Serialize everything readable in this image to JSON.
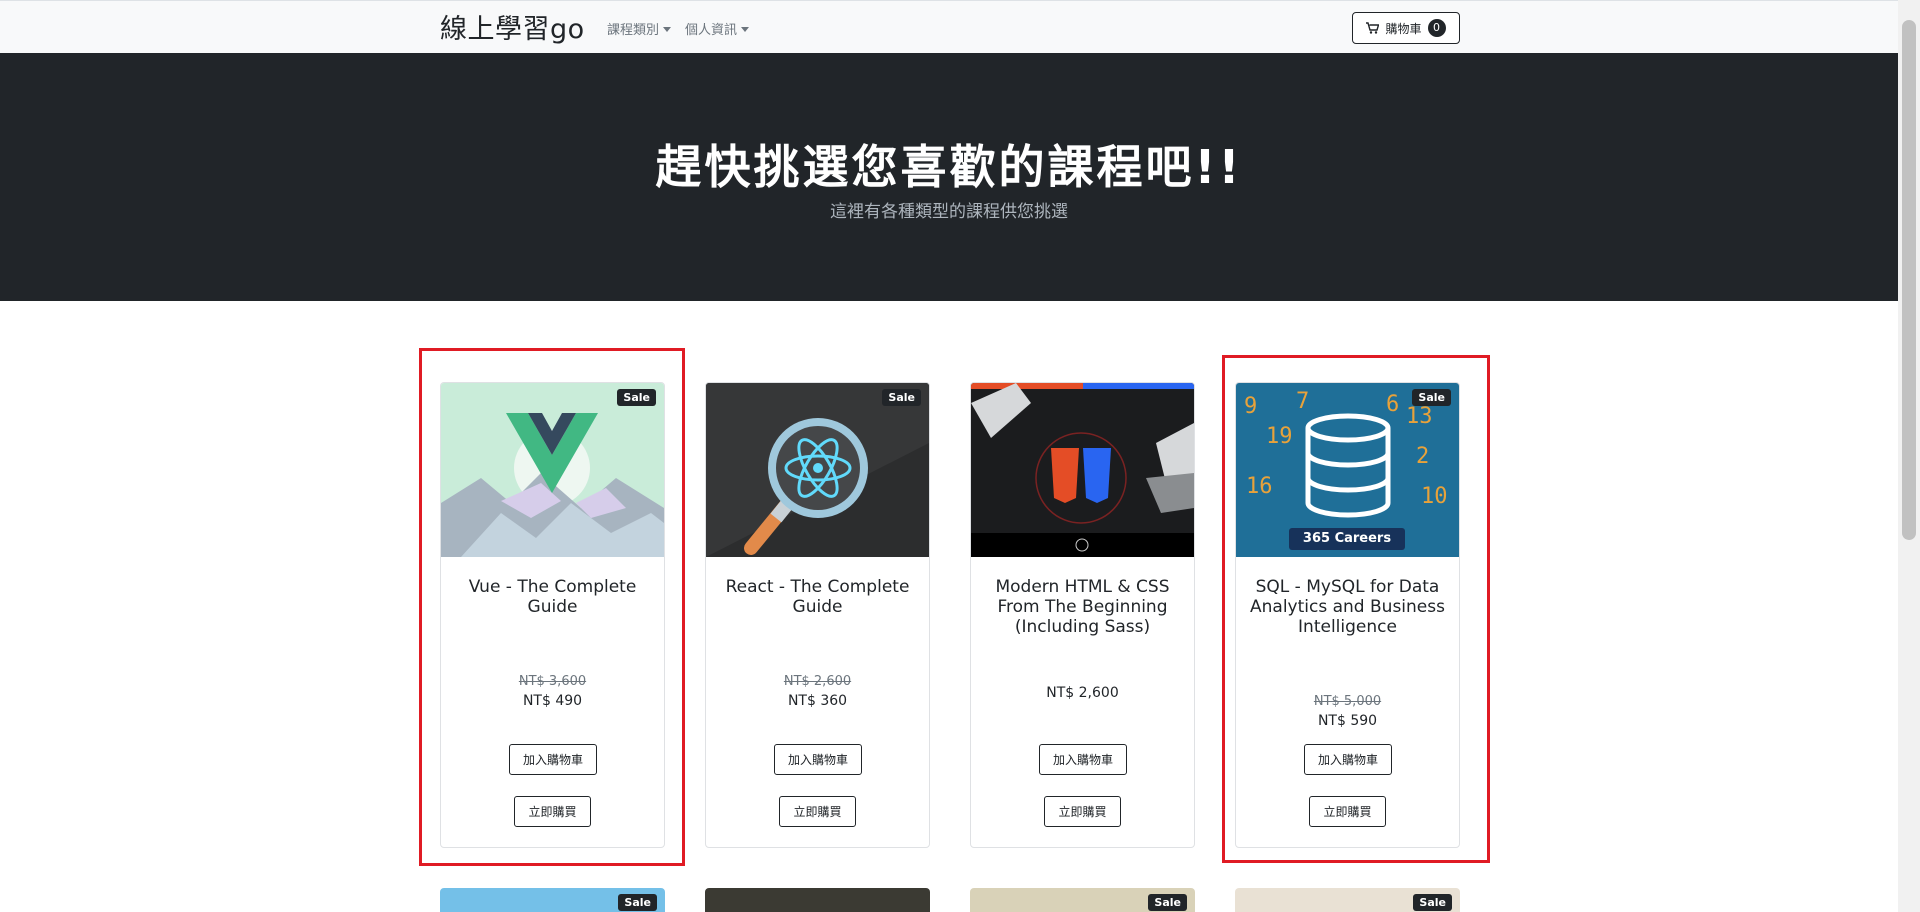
{
  "nav": {
    "brand": "線上學習go",
    "items": [
      {
        "label": "課程類別"
      },
      {
        "label": "個人資訊"
      }
    ],
    "cart_label": "購物車",
    "cart_count": "0"
  },
  "hero": {
    "title": "趕快挑選您喜歡的課程吧!!",
    "subtitle": "這裡有各種類型的課程供您挑選"
  },
  "cards": [
    {
      "title": "Vue - The Complete Guide",
      "badge": "Sale",
      "original_price": "NT$ 3,600",
      "price": "NT$ 490",
      "add_label": "加入購物車",
      "buy_label": "立即購買"
    },
    {
      "title": "React - The Complete Guide",
      "badge": "Sale",
      "original_price": "NT$ 2,600",
      "price": "NT$ 360",
      "add_label": "加入購物車",
      "buy_label": "立即購買"
    },
    {
      "title": "Modern HTML & CSS From The Beginning (Including Sass)",
      "badge": "",
      "original_price": "",
      "price": "NT$ 2,600",
      "add_label": "加入購物車",
      "buy_label": "立即購買"
    },
    {
      "title": "SQL - MySQL for Data Analytics and Business Intelligence",
      "badge": "Sale",
      "original_price": "NT$ 5,000",
      "price": "NT$ 590",
      "add_label": "加入購物車",
      "buy_label": "立即購買"
    }
  ],
  "bottom_badges": [
    "Sale",
    "Sale",
    "Sale"
  ],
  "image_text": {
    "sql_brand": "365 Careers"
  },
  "colors": {
    "dark": "#212529",
    "highlight": "#e01b24",
    "navbar_bg": "#f8f9fa"
  }
}
